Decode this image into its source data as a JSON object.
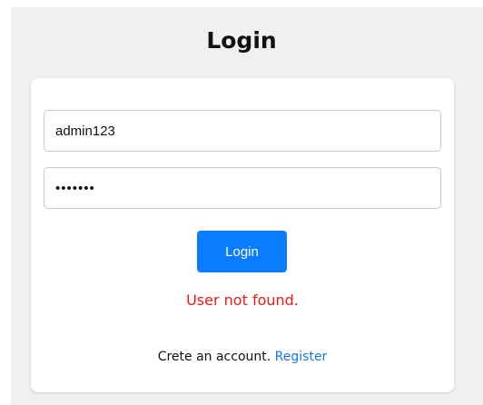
{
  "page": {
    "title": "Login"
  },
  "form": {
    "username_value": "admin123",
    "password_value": "1234567",
    "login_button_label": "Login",
    "error_message": "User not found."
  },
  "footer": {
    "prompt_text": "Crete an account.",
    "register_link_label": "Register"
  },
  "colors": {
    "accent": "#0a7cff",
    "error": "#f01818",
    "link": "#1a73e8",
    "background": "#f0f0f0"
  }
}
